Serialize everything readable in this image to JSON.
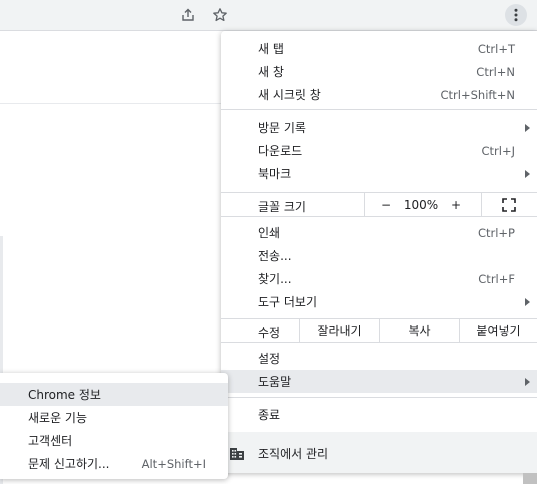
{
  "menu": {
    "group1": [
      {
        "label": "새 탭",
        "shortcut": "Ctrl+T"
      },
      {
        "label": "새 창",
        "shortcut": "Ctrl+N"
      },
      {
        "label": "새 시크릿 창",
        "shortcut": "Ctrl+Shift+N"
      }
    ],
    "group2": [
      {
        "label": "방문 기록",
        "shortcut": ""
      },
      {
        "label": "다운로드",
        "shortcut": "Ctrl+J"
      },
      {
        "label": "북마크",
        "shortcut": ""
      }
    ],
    "zoom": {
      "label": "글꼴 크기",
      "minus": "−",
      "value": "100%",
      "plus": "+"
    },
    "group3": [
      {
        "label": "인쇄",
        "shortcut": "Ctrl+P"
      },
      {
        "label": "전송...",
        "shortcut": ""
      },
      {
        "label": "찾기...",
        "shortcut": "Ctrl+F"
      },
      {
        "label": "도구 더보기",
        "shortcut": ""
      }
    ],
    "edit": {
      "label": "수정",
      "cut": "잘라내기",
      "copy": "복사",
      "paste": "붙여넣기"
    },
    "group4": [
      {
        "label": "설정"
      },
      {
        "label": "도움말"
      }
    ],
    "exit": "종료",
    "managed": "조직에서 관리"
  },
  "help_submenu": [
    {
      "label": "Chrome 정보",
      "shortcut": ""
    },
    {
      "label": "새로운 기능",
      "shortcut": ""
    },
    {
      "label": "고객센터",
      "shortcut": ""
    },
    {
      "label": "문제 신고하기...",
      "shortcut": "Alt+Shift+I"
    }
  ],
  "icons": {
    "share": "share-icon",
    "bookmark": "star-icon",
    "menu": "kebab-menu-icon",
    "fullscreen": "fullscreen-icon",
    "building": "building-icon"
  }
}
